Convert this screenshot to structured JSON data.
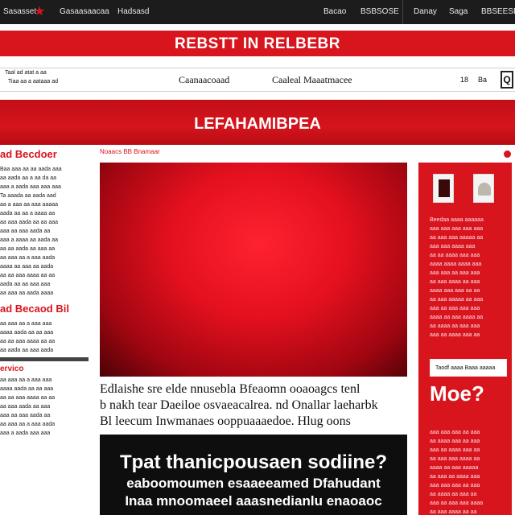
{
  "topbar": {
    "items": [
      "Sasasset",
      "Gasaasaacaa",
      "Hadsasd",
      "Bacao",
      "BSBSOSE",
      "Danay",
      "Saga",
      "BBSEESB"
    ]
  },
  "banner": {
    "title": "REBSTT IN RELBEBR"
  },
  "nav": {
    "left_line1": "Taal ad atat a aa",
    "left_line2": "Tiaa aa a aataaa ad",
    "mid1": "Caanaacoaad",
    "mid2": "Caaleal Maaatmacee",
    "num1": "18",
    "num2": "Ba",
    "search_icon": "search-icon"
  },
  "section": {
    "title": "LEFAHAMIBPEA"
  },
  "left_column": {
    "heading1": "ad Becdoer",
    "lines1": [
      "Baa aaa aa aa aada aaa",
      "aa aada aa a aa da aa",
      "aaa a aada aaa aaa aaa",
      "Ta aaada aa aada aad",
      "aa a aaa aa aaa aaaaa",
      "aada aa aa a aaaa aa",
      "aa aaa aada aa aa aaa",
      "aaa aa aaa aada aa",
      "aaa a aaaa aa aada aa",
      "aa aa aada aa aaa aa",
      "aa aaa aa a aaa aada",
      "aaaa aa aaa aa aada",
      "aa aa aaa aaaa aa aa",
      "aada aa aa aaa aaa",
      "aa aaa aa aada aaaa"
    ],
    "heading2": "ad Becaod Bil",
    "lines2": [
      "aa aaa aa a aaa aaa",
      "aaaa aada aa aa aaa",
      "aa aa aaa aaaa aa aa",
      "aa aada aa aaa aada"
    ],
    "heading3": "ervico",
    "lines3": [
      "aa aaa aa a aaa aaa",
      "aaaa aada aa aa aaa",
      "aa aa aaa aaaa aa aa",
      "aa aaa aada aa aaa",
      "aaa aa aaa aada aa",
      "aa aaa aa a aaa aada",
      "aaa a aada aaa aaa"
    ]
  },
  "hero": {
    "label": "Noaacs BB Bnamaar",
    "caption": [
      "Edlaishe sre elde nnusebla Bfeaomn ooaoagcs tenl",
      "b nakh tear Daeiloe osvaeacalrea. nd Onallar laeharbk",
      "Bl leecum Inwmanaes ooppuaaaedoe. Hlug oons"
    ]
  },
  "dark_panel": {
    "heading": "Tpat thanicpousaen sodiine?",
    "line1": "eaboomoumen esaaeeamed Dfahudant",
    "line2": "Inaa mnoomaeel aaasnedianlu enaoaoc"
  },
  "sidebar": {
    "text1": [
      "Beedaa aaaa aaaaaa",
      "aaa aaa aaa aaa aaa",
      "aa aaa aaa aaaaa aa",
      "aaa aaa aaaa aaa",
      "aa aa aaaa aaa aaa",
      "aaaa aaaa aaaa aaa",
      "aaa aaa aa aaa aaa",
      "aa aaa aaaa aa aaa",
      "aaaa aaa aaa aa aa",
      "aa aaa aaaaa aa aaa",
      "aaa aa aaa aaa aaa",
      "aaaa aa aaa aaaa aa",
      "aa aaaa aa aaa aaa",
      "aaa aa aaaa aaa aa"
    ],
    "input_value": "Taodf aaaa Baaa aaaaa",
    "more_label": "Moe?",
    "text2": [
      "aaa aaa aaa aa aaa",
      "aa aaaa aaa aa aaa",
      "aaa aa aaaa aaa aa",
      "aa aaa aaa aaaa aa",
      "aaaa aa aaa aaaaa",
      "aa aaa aa aaaa aaa",
      "aaa aaa aaa aa aaa",
      "aa aaaa aa aaa aa",
      "aaa aa aaa aaa aaaa",
      "aa aaa aaaa aa aa"
    ]
  }
}
